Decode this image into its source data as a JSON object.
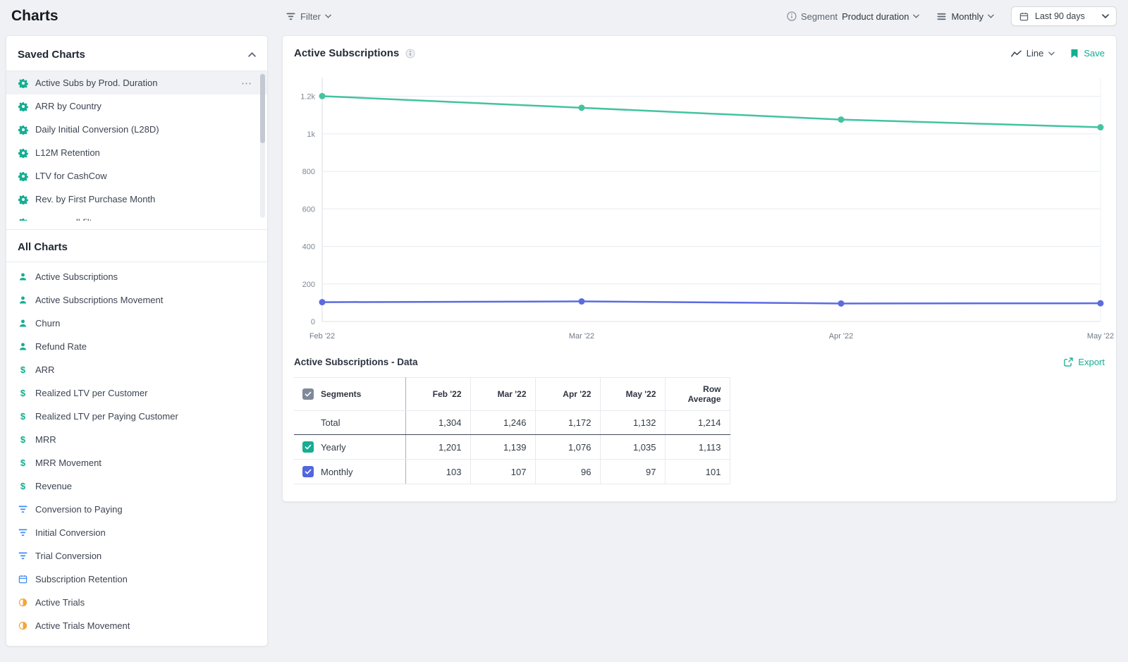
{
  "page": {
    "title": "Charts"
  },
  "topbar": {
    "filter_label": "Filter",
    "segment_label": "Segment",
    "segment_value": "Product duration",
    "interval_value": "Monthly",
    "date_range_value": "Last 90 days"
  },
  "sidebar": {
    "saved_charts": {
      "title": "Saved Charts",
      "items": [
        {
          "label": "Active Subs by Prod. Duration",
          "icon": "gear-icon",
          "color": "teal",
          "active": true
        },
        {
          "label": "ARR by Country",
          "icon": "gear-icon",
          "color": "teal"
        },
        {
          "label": "Daily Initial Conversion (L28D)",
          "icon": "gear-icon",
          "color": "teal"
        },
        {
          "label": "L12M Retention",
          "icon": "gear-icon",
          "color": "teal"
        },
        {
          "label": "LTV for CashCow",
          "icon": "gear-icon",
          "color": "teal"
        },
        {
          "label": "Rev. by First Purchase Month",
          "icon": "gear-icon",
          "color": "teal"
        },
        {
          "label": "revenue all filters",
          "icon": "gear-icon",
          "color": "teal"
        }
      ]
    },
    "all_charts": {
      "title": "All Charts",
      "items": [
        {
          "label": "Active Subscriptions",
          "icon": "user-icon",
          "color": "teal"
        },
        {
          "label": "Active Subscriptions Movement",
          "icon": "user-icon",
          "color": "teal"
        },
        {
          "label": "Churn",
          "icon": "user-icon",
          "color": "teal"
        },
        {
          "label": "Refund Rate",
          "icon": "user-icon",
          "color": "teal"
        },
        {
          "label": "ARR",
          "icon": "dollar-icon",
          "color": "teal"
        },
        {
          "label": "Realized LTV per Customer",
          "icon": "dollar-icon",
          "color": "teal"
        },
        {
          "label": "Realized LTV per Paying Customer",
          "icon": "dollar-icon",
          "color": "teal"
        },
        {
          "label": "MRR",
          "icon": "dollar-icon",
          "color": "teal"
        },
        {
          "label": "MRR Movement",
          "icon": "dollar-icon",
          "color": "teal"
        },
        {
          "label": "Revenue",
          "icon": "dollar-icon",
          "color": "teal"
        },
        {
          "label": "Conversion to Paying",
          "icon": "funnel-icon",
          "color": "blue"
        },
        {
          "label": "Initial Conversion",
          "icon": "funnel-icon",
          "color": "blue"
        },
        {
          "label": "Trial Conversion",
          "icon": "funnel-icon",
          "color": "blue"
        },
        {
          "label": "Subscription Retention",
          "icon": "calendar-icon",
          "color": "blue"
        },
        {
          "label": "Active Trials",
          "icon": "trial-icon",
          "color": "orange"
        },
        {
          "label": "Active Trials Movement",
          "icon": "trial-icon",
          "color": "orange"
        }
      ]
    }
  },
  "main": {
    "chart_card": {
      "title": "Active Subscriptions",
      "chart_type_label": "Line",
      "save_label": "Save"
    },
    "data_section": {
      "title": "Active Subscriptions - Data",
      "export_label": "Export"
    },
    "table": {
      "columns": [
        "Segments",
        "Feb '22",
        "Mar '22",
        "Apr '22",
        "May '22",
        "Row Average"
      ],
      "header_checkbox": {
        "checked": true,
        "color": "gray_checkbox"
      },
      "rows": [
        {
          "label": "Total",
          "checkbox": null,
          "checked": false,
          "values": [
            "1,304",
            "1,246",
            "1,172",
            "1,132",
            "1,214"
          ]
        },
        {
          "label": "Yearly",
          "checkbox": "teal",
          "checked": true,
          "values": [
            "1,201",
            "1,139",
            "1,076",
            "1,035",
            "1,113"
          ]
        },
        {
          "label": "Monthly",
          "checkbox": "purple",
          "checked": true,
          "values": [
            "103",
            "107",
            "96",
            "97",
            "101"
          ]
        }
      ]
    }
  },
  "chart_data": {
    "type": "line",
    "title": "Active Subscriptions",
    "x": [
      "Feb '22",
      "Mar '22",
      "Apr '22",
      "May '22"
    ],
    "series": [
      {
        "name": "Yearly",
        "color": "#43C39F",
        "values": [
          1201,
          1139,
          1076,
          1035
        ]
      },
      {
        "name": "Monthly",
        "color": "#5C6BE0",
        "values": [
          103,
          107,
          96,
          97
        ]
      }
    ],
    "ylim": [
      0,
      1300
    ],
    "yticks": [
      0,
      200,
      400,
      600,
      800,
      1000,
      1200
    ],
    "ytick_labels": [
      "0",
      "200",
      "400",
      "600",
      "800",
      "1k",
      "1.2k"
    ],
    "grid": true,
    "legend": "none"
  },
  "colors": {
    "teal": "#14ae92",
    "blue": "#3d8af7",
    "orange": "#f2a63c",
    "purple": "#5266e0",
    "gray_checkbox": "#7e8a99",
    "background": "#f0f1f4"
  }
}
